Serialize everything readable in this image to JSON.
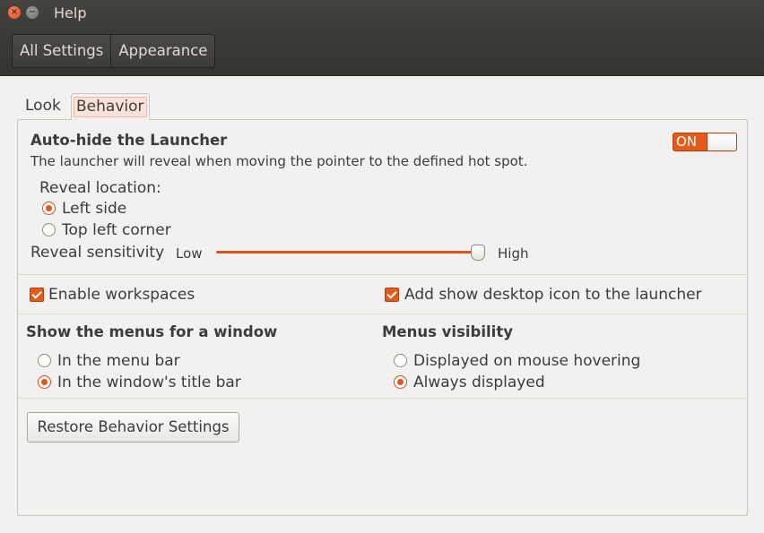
{
  "window": {
    "title": "Help",
    "close_symbol": "×",
    "minimize_symbol": "−"
  },
  "toolbar": {
    "crumbs": [
      "All Settings",
      "Appearance"
    ]
  },
  "tabs": [
    {
      "label": "Look",
      "active": false
    },
    {
      "label": "Behavior",
      "active": true
    }
  ],
  "autohide": {
    "title": "Auto-hide the Launcher",
    "description": "The launcher will reveal when moving the pointer to the defined hot spot.",
    "switch_label": "ON",
    "switch_on": true,
    "reveal_location_label": "Reveal location:",
    "options": [
      {
        "label": "Left side",
        "selected": true
      },
      {
        "label": "Top left corner",
        "selected": false
      }
    ],
    "sensitivity_label": "Reveal sensitivity",
    "low_label": "Low",
    "high_label": "High",
    "sensitivity_value": 1.0
  },
  "checks": {
    "workspaces": {
      "label": "Enable workspaces",
      "checked": true
    },
    "desktop_icon": {
      "label": "Add show desktop icon to the launcher",
      "checked": true
    }
  },
  "menus_window": {
    "title": "Show the menus for a window",
    "options": [
      {
        "label": "In the menu bar",
        "selected": false
      },
      {
        "label": "In the window's title bar",
        "selected": true
      }
    ]
  },
  "menus_visibility": {
    "title": "Menus visibility",
    "options": [
      {
        "label": "Displayed on mouse hovering",
        "selected": false
      },
      {
        "label": "Always displayed",
        "selected": true
      }
    ]
  },
  "restore_button": "Restore Behavior Settings",
  "colors": {
    "accent": "#e45a1b",
    "titlebar": "#3c3b37",
    "background": "#f2f1f0"
  }
}
